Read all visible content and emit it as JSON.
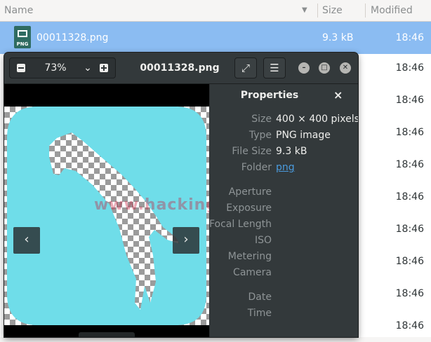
{
  "file_manager": {
    "columns": {
      "name": "Name",
      "size": "Size",
      "modified": "Modified",
      "sort_arrow": "▼"
    },
    "selected_file": {
      "name": "00011328.png",
      "size": "9.3 kB",
      "modified": "18:46",
      "icon_label": "PNG"
    },
    "rows": [
      {
        "modified": "18:46"
      },
      {
        "modified": "18:46"
      },
      {
        "modified": "18:46"
      },
      {
        "modified": "18:46"
      },
      {
        "modified": "18:46"
      },
      {
        "modified": "18:46"
      },
      {
        "modified": "18:46"
      },
      {
        "modified": "18:46"
      },
      {
        "modified": "18:46"
      }
    ]
  },
  "viewer": {
    "title": "00011328.png",
    "zoom": "73%",
    "icons": {
      "zoom_out": "zoom-out-icon",
      "zoom_in": "zoom-in-icon",
      "chevron": "chevron-down-icon",
      "fullscreen": "fullscreen-icon",
      "menu": "hamburger-menu-icon",
      "minimize": "minimize-icon",
      "maximize": "maximize-icon",
      "close": "close-icon",
      "prev": "chevron-left-icon",
      "next": "chevron-right-icon",
      "rotate_left": "rotate-left-icon",
      "rotate_right": "rotate-right-icon"
    },
    "glyphs": {
      "chevron": "⌄",
      "fullscreen": "⤢",
      "menu": "☰",
      "prev": "‹",
      "next": "›",
      "rotate_left": "↶",
      "rotate_right": "↷"
    },
    "watermark": "www.hackingarticles.in",
    "image_colors": {
      "background_shape": "#6fdde9",
      "transparency_check": "#9b9b9b"
    },
    "properties": {
      "title": "Properties",
      "close_glyph": "×",
      "fields": [
        {
          "key": "Size",
          "value": "400 × 400 pixels"
        },
        {
          "key": "Type",
          "value": "PNG image"
        },
        {
          "key": "File Size",
          "value": "9.3 kB"
        },
        {
          "key": "Folder",
          "value": "png"
        }
      ],
      "exif_labels": [
        "Aperture",
        "Exposure",
        "Focal Length",
        "ISO",
        "Metering",
        "Camera"
      ],
      "date_labels": [
        "Date",
        "Time"
      ]
    }
  }
}
